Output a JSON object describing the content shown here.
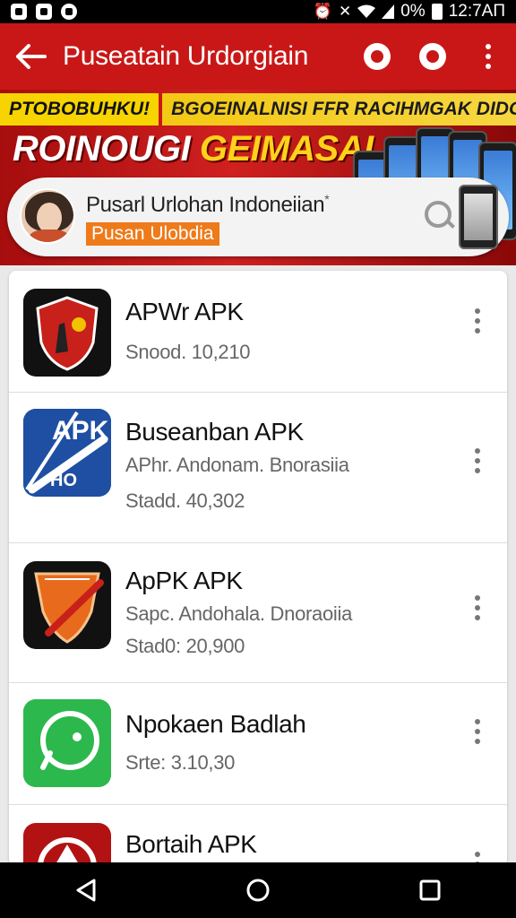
{
  "status_bar": {
    "time": "12:7AП",
    "battery": "0%",
    "left_icons": [
      "notification-icon",
      "notification-icon",
      "notification-icon"
    ],
    "right_icons": [
      "alarm-icon",
      "mute-icon",
      "wifi-icon",
      "signal-icon",
      "battery-icon"
    ]
  },
  "app_bar": {
    "title": "Puseatain Urdorgiain",
    "back_icon": "back-arrow-icon",
    "actions": [
      "search-icon",
      "sync-icon",
      "more-vert-icon"
    ]
  },
  "banner": {
    "strip_tag": "PTOBOBUHKU!",
    "strip_text": "BGOEINALNISI FFR RACIHMGAK DIDOSNOAN",
    "headline_part1": "ROINOUGI ",
    "headline_part2": "GEIMASAI"
  },
  "profile": {
    "name": "Pusarl Urlohan Indoneiian",
    "tag": "Pusan Ulobdia",
    "superscript": "*"
  },
  "apps": [
    {
      "title": "APWr APK",
      "lines": [
        "Snood. 10,210"
      ]
    },
    {
      "title": "Buseanban APK",
      "lines": [
        "APhr. Andonam. Bnorasiia",
        "Stadd. 40,302"
      ]
    },
    {
      "title": "ApPK APK",
      "lines": [
        "Sapc. Andohala. Dnoraoiia",
        "Stad0: 20,900"
      ]
    },
    {
      "title": "Npokaen Badlah",
      "lines": [
        "Srte: 3.10,30"
      ]
    },
    {
      "title": "Bortaih APK",
      "lines": []
    }
  ],
  "app_icon_badges": {
    "apk_text": "APK",
    "hq_text": "HO"
  },
  "nav_bar": {
    "buttons": [
      "back-triangle-icon",
      "home-circle-icon",
      "recents-square-icon"
    ]
  },
  "colors": {
    "accent": "#c91717",
    "tag": "#ee7a1a",
    "banner_yellow": "#f7d400"
  }
}
